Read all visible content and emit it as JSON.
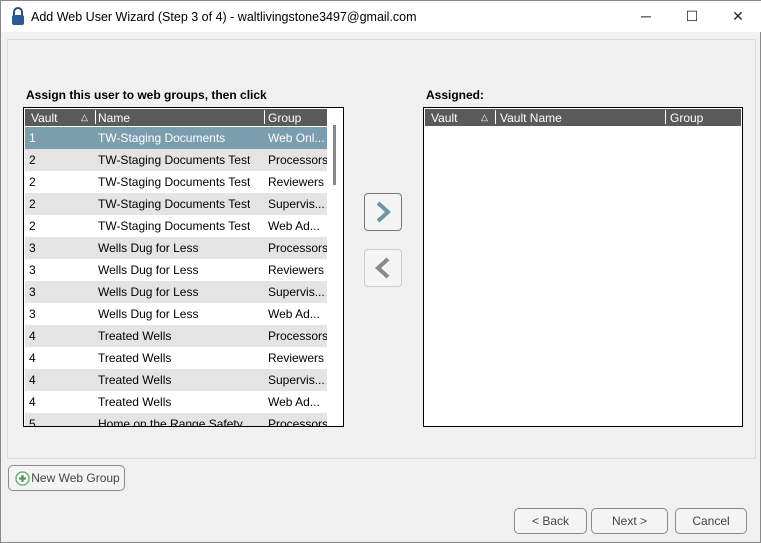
{
  "window": {
    "title": "Add Web User Wizard (Step 3 of 4) - waltlivingstone3497@gmail.com",
    "minimize": "─",
    "maximize": "☐",
    "close": "✕"
  },
  "available": {
    "label": "Assign this user to web groups, then click",
    "columns": [
      "Vault",
      "Name",
      "Group"
    ],
    "sort_indicator": "△",
    "rows": [
      {
        "vault": "1",
        "name": "TW-Staging Documents",
        "group": "Web Onl...",
        "selected": true
      },
      {
        "vault": "2",
        "name": "TW-Staging Documents Test",
        "group": "Processors"
      },
      {
        "vault": "2",
        "name": "TW-Staging Documents Test",
        "group": "Reviewers"
      },
      {
        "vault": "2",
        "name": "TW-Staging Documents Test",
        "group": "Supervis..."
      },
      {
        "vault": "2",
        "name": "TW-Staging Documents Test",
        "group": "Web Ad..."
      },
      {
        "vault": "3",
        "name": "Wells Dug for Less",
        "group": "Processors"
      },
      {
        "vault": "3",
        "name": "Wells Dug for Less",
        "group": "Reviewers"
      },
      {
        "vault": "3",
        "name": "Wells Dug for Less",
        "group": "Supervis..."
      },
      {
        "vault": "3",
        "name": "Wells Dug for Less",
        "group": "Web Ad..."
      },
      {
        "vault": "4",
        "name": "Treated Wells",
        "group": "Processors"
      },
      {
        "vault": "4",
        "name": "Treated Wells",
        "group": "Reviewers"
      },
      {
        "vault": "4",
        "name": "Treated Wells",
        "group": "Supervis..."
      },
      {
        "vault": "4",
        "name": "Treated Wells",
        "group": "Web Ad..."
      },
      {
        "vault": "5",
        "name": "Home on the Range Safety",
        "group": "Processors"
      }
    ]
  },
  "assigned": {
    "label": "Assigned:",
    "columns": [
      "Vault",
      "Vault Name",
      "Group"
    ],
    "sort_indicator": "△"
  },
  "buttons": {
    "new_web_group": "New Web Group",
    "back": "< Back",
    "next": "Next >",
    "cancel": "Cancel"
  }
}
